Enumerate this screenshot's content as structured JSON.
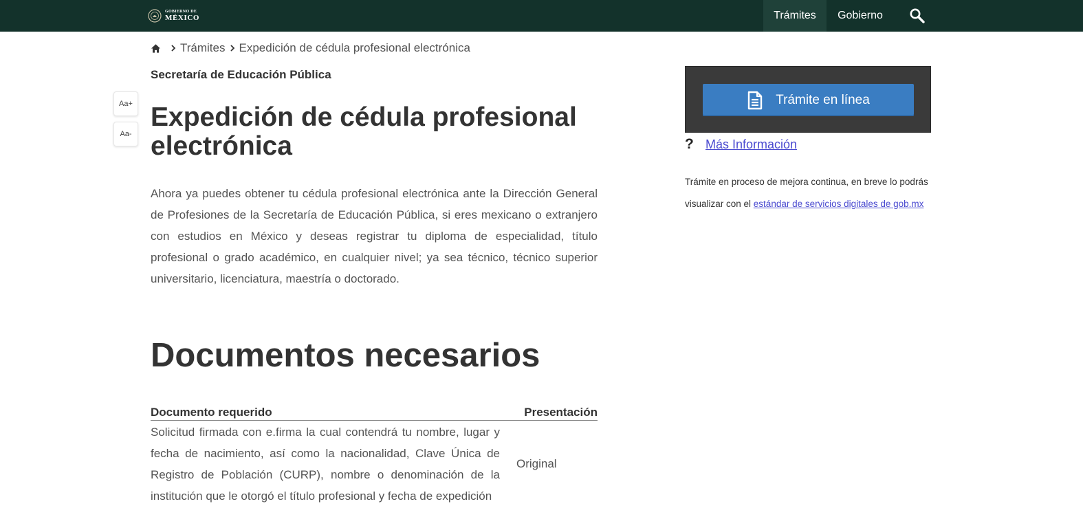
{
  "header": {
    "logo_top": "GOBIERNO DE",
    "logo_bottom": "MÉXICO",
    "nav": [
      {
        "label": "Trámites",
        "active": true
      },
      {
        "label": "Gobierno",
        "active": false
      }
    ],
    "search_icon": "search-icon",
    "bg_color": "#13322b",
    "active_color": "#1f4139"
  },
  "breadcrumb": {
    "home_icon": "home-icon",
    "items": [
      "Trámites",
      "Expedición de cédula profesional electrónica"
    ]
  },
  "font_tools": {
    "increase": "Aa+",
    "decrease": "Aa-"
  },
  "main": {
    "dependency": "Secretaría de Educación Pública",
    "title": "Expedición de cédula profesional electrónica",
    "intro": "Ahora ya puedes obtener tu cédula profesional electrónica ante la Dirección General de Profesiones de la Secretaría de Educación Pública, si eres mexicano o extranjero con estudios en México y deseas registrar tu diploma de especialidad, título profesional o grado académico, en cualquier nivel; ya sea técnico, técnico superior universitario, licenciatura, maestría o doctorado.",
    "documents": {
      "title": "Documentos necesarios",
      "headers": [
        "Documento requerido",
        "Presentación"
      ],
      "rows": [
        {
          "document": "Solicitud firmada con e.firma la cual contendrá tu nombre, lugar y fecha de nacimiento, así como la nacionalidad, Clave Única de Registro de Población (CURP), nombre o denominación de la institución que le otorgó el título profesional y fecha de expedición",
          "presentation": "Original"
        }
      ]
    }
  },
  "sidebar": {
    "online_button": "Trámite en línea",
    "online_icon": "document-icon",
    "button_color": "#3a7dc2",
    "more_info_mark": "?",
    "more_info_link": "Más Información",
    "notice_text": "Trámite en proceso de mejora continua, en breve lo podrás visualizar con el ",
    "notice_link": "estándar de servicios digitales de gob.mx"
  }
}
